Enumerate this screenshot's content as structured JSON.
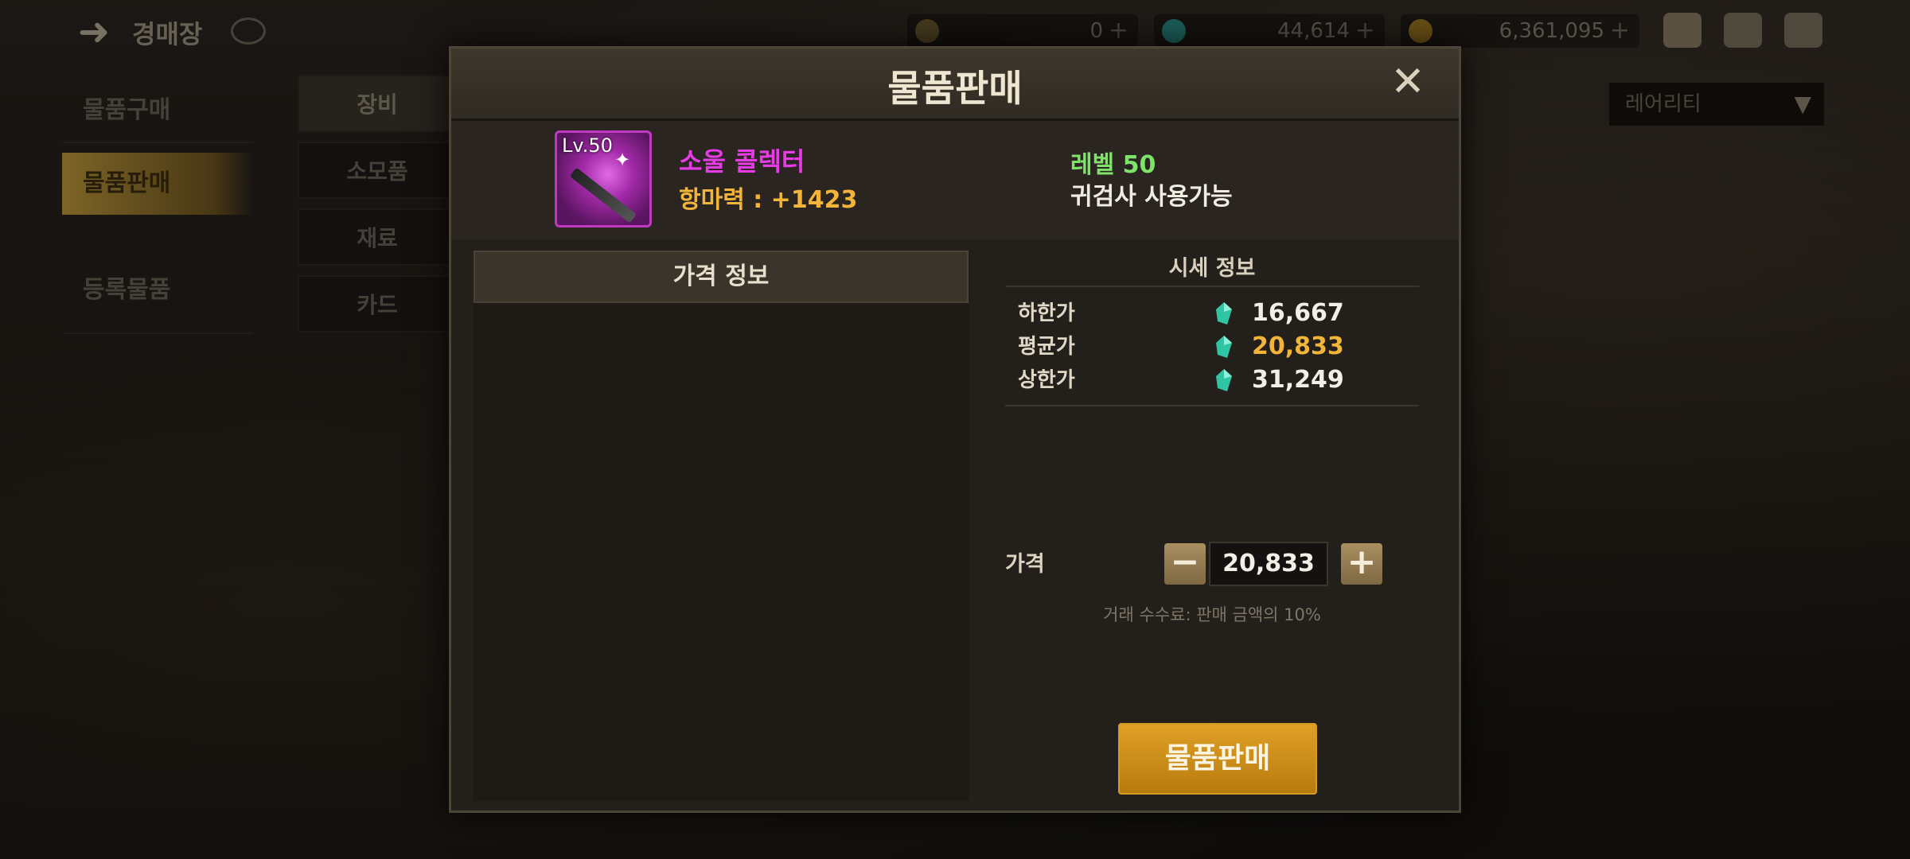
{
  "topbar": {
    "title": "경매장",
    "currencies": [
      {
        "icon": "moon-coin-icon",
        "amount": "0"
      },
      {
        "icon": "green-gem-icon",
        "amount": "44,614"
      },
      {
        "icon": "gold-coin-icon",
        "amount": "6,361,095"
      }
    ]
  },
  "left_menu": {
    "items": [
      "물품구매",
      "물품판매",
      "등록물품"
    ],
    "active_index": 1
  },
  "sub_tabs": {
    "items": [
      "장비",
      "소모품",
      "재료",
      "카드"
    ],
    "active_index": 0
  },
  "filter": {
    "selected": "레어리티"
  },
  "modal": {
    "title": "물품판매",
    "item": {
      "level_badge": "Lv.50",
      "name": "소울 콜렉터",
      "stat": "항마력 : +1423",
      "required_level": "레벨 50",
      "class_req": "귀검사 사용가능"
    },
    "price_info_header": "가격 정보",
    "market": {
      "title": "시세 정보",
      "rows": [
        {
          "label": "하한가",
          "value": "16,667"
        },
        {
          "label": "평균가",
          "value": "20,833"
        },
        {
          "label": "상한가",
          "value": "31,249"
        }
      ]
    },
    "price": {
      "label": "가격",
      "value": "20,833",
      "minus": "−",
      "plus": "+",
      "fee_note": "거래 수수료: 판매 금액의 10%"
    },
    "sell_button": "물품판매"
  },
  "colors": {
    "item_name": "#e53ce5",
    "stat": "#f2b53a",
    "level": "#7fe36a",
    "avg_price": "#f2b53a",
    "sell_button": "#d69417"
  }
}
